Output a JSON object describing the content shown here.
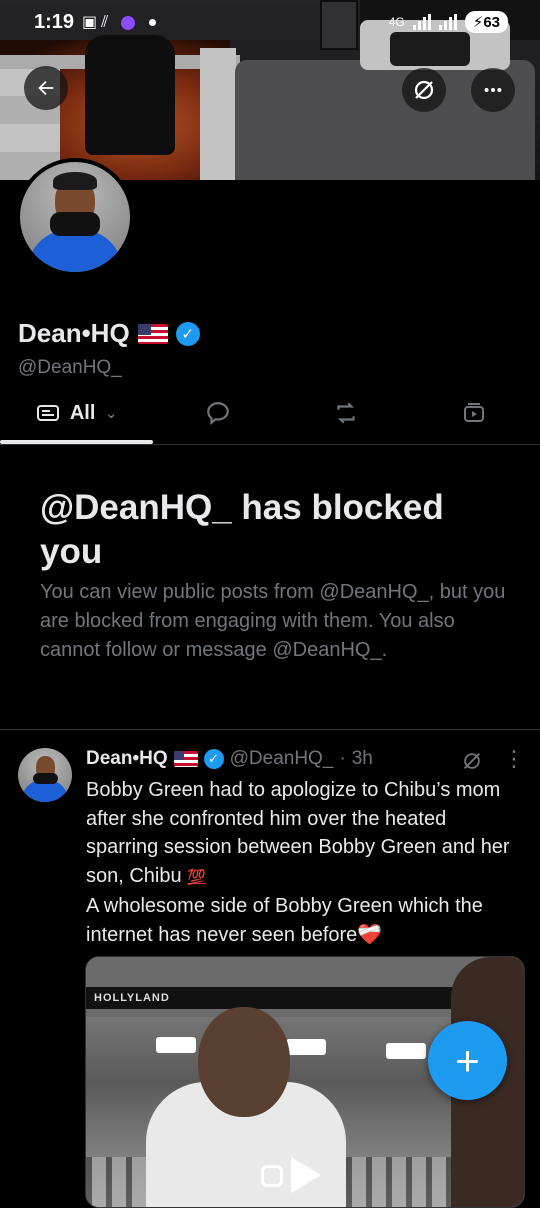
{
  "status_bar": {
    "time": "1:19",
    "network": "4G",
    "battery": "63"
  },
  "header": {
    "back_icon": "back-arrow-icon",
    "grok_icon": "grok-icon",
    "more_icon": "more-horizontal-icon"
  },
  "profile": {
    "name": "Dean•HQ",
    "flag": "🇺🇸",
    "handle": "@DeanHQ_",
    "verified_check": "✓"
  },
  "tabs": {
    "all_label": "All",
    "chevron": "⌄",
    "items": [
      "all",
      "replies",
      "reposts",
      "videos"
    ]
  },
  "blocked": {
    "title": "@DeanHQ_ has blocked you",
    "description": "You can view public posts from @DeanHQ_, but you are blocked from engaging with them. You also cannot follow or message @DeanHQ_."
  },
  "post": {
    "name": "Dean•HQ",
    "handle": "@DeanHQ_",
    "separator": "·",
    "time": "3h",
    "text_line1": "Bobby Green had to apologize to Chibu’s mom after she confronted him over the heated sparring session between Bobby Green and her son, Chibu",
    "emoji_100": "💯",
    "text_line2": "A wholesome side of Bobby Green which the internet has never seen before",
    "emoji_heart": "❤️‍🩹",
    "media_banner": "HOLLYLAND",
    "more_dots": "⋮"
  },
  "fab": {
    "label": "+"
  },
  "colors": {
    "accent": "#1d9bf0",
    "background": "#000000",
    "muted_text": "#71767b"
  }
}
